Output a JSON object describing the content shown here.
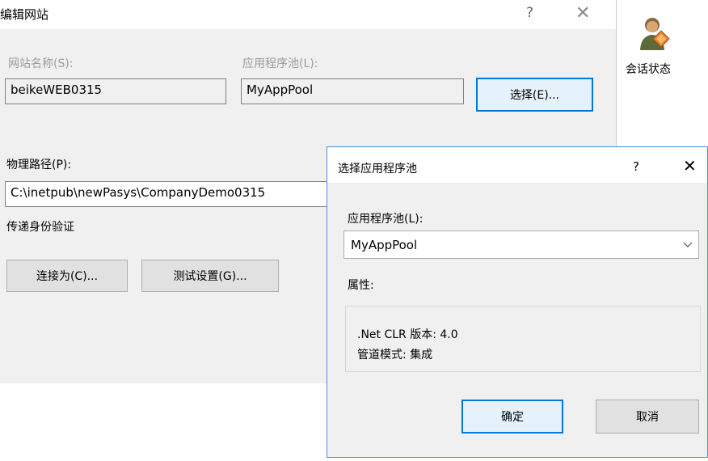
{
  "edit_dialog": {
    "title": "编辑网站",
    "help": "?",
    "close": "✕",
    "site_name_label": "网站名称(S):",
    "site_name_value": "beikeWEB0315",
    "app_pool_label": "应用程序池(L):",
    "app_pool_value": "MyAppPool",
    "select_button": "选择(E)...",
    "physical_path_label": "物理路径(P):",
    "physical_path_value": "C:\\inetpub\\newPasys\\CompanyDemo0315",
    "pass_through_label": "传递身份验证",
    "connect_as_button": "连接为(C)...",
    "test_settings_button": "测试设置(G)..."
  },
  "side_pane": {
    "session_state_label": "会话状态",
    "icon": "user-diamond-icon"
  },
  "pool_dialog": {
    "title": "选择应用程序池",
    "help": "?",
    "close": "✕",
    "app_pool_label": "应用程序池(L):",
    "app_pool_selected": "MyAppPool",
    "properties_label": "属性:",
    "clr_version": ".Net CLR 版本: 4.0",
    "pipeline_mode": "管道模式: 集成",
    "ok_button": "确定",
    "cancel_button": "取消"
  },
  "colors": {
    "dialog_bg": "#f0f0f0",
    "focus_border": "#0078d7",
    "pool_dialog_border": "#4a8fd6"
  }
}
